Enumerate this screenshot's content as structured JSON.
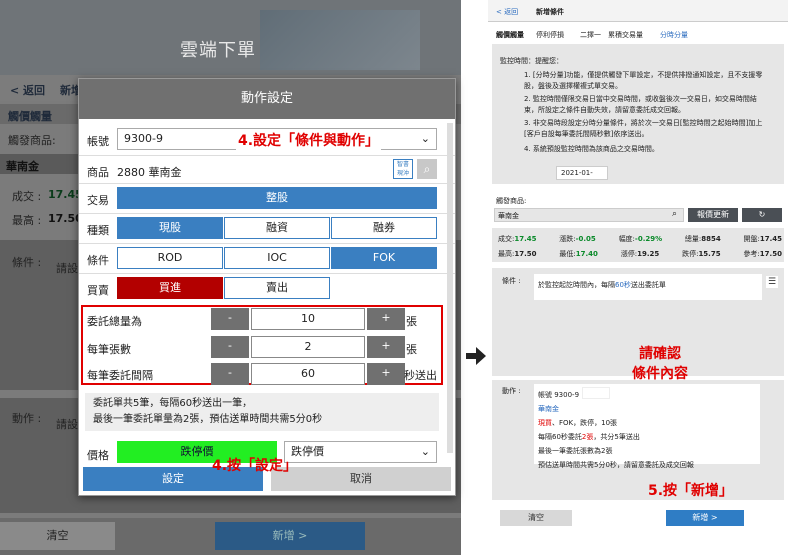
{
  "left_app": {
    "header_title": "雲端下單",
    "back": "< 返回",
    "nav_title": "新增",
    "tab": "觸價觸量",
    "tab2": "停",
    "monitor_label": "觸發商品:",
    "stock": "華南金",
    "deal_label": "成交 :",
    "deal_value": "17.45",
    "high_label": "最高 :",
    "high_value": "17.50",
    "condition_label": "條件 :",
    "condition_text": "請設",
    "action_label": "動作 :",
    "action_text": "請設",
    "clear_button": "清空",
    "new_button": "新增 >"
  },
  "dialog": {
    "title": "動作設定",
    "account_label": "帳號",
    "account_value": "9300-9",
    "product_label": "商品",
    "product_value": "2880 華南金",
    "quote_icon_text": "智書\n現沖",
    "trade_label": "交易",
    "trade_value": "整股",
    "type_label": "種類",
    "type_options": [
      "現股",
      "融資",
      "融券"
    ],
    "cond_label": "條件",
    "cond_options": [
      "ROD",
      "IOC",
      "FOK"
    ],
    "buysell_label": "買賣",
    "buysell_options": [
      "買進",
      "賣出"
    ],
    "qty_total_label": "委託總量為",
    "qty_total_value": "10",
    "qty_total_unit": "張",
    "qty_each_label": "每筆張數",
    "qty_each_value": "2",
    "qty_each_unit": "張",
    "interval_label": "每筆委託間隔",
    "interval_value": "60",
    "interval_unit": "秒送出",
    "minus": "-",
    "plus": "+",
    "summary_line1": "委託單共5筆，每隔60秒送出一筆，",
    "summary_line2": "最後一筆委託單量為2張，預估送單時間共需5分0秒",
    "price_label": "價格",
    "price_value": "跌停價",
    "price_select": "跌停價",
    "confirm_button": "設定",
    "cancel_button": "取消"
  },
  "annotations": {
    "set_condition": "4.設定「條件與動作」",
    "press_set": "4.按「設定」",
    "confirm": "請確認\n條件內容",
    "press_new": "5.按「新增」"
  },
  "right_panel": {
    "back": "< 返回",
    "title": "新增條件",
    "tabs": [
      "觸價觸量",
      "停利停損",
      "二擇一",
      "累積交易量",
      "分時分量"
    ],
    "notice_title": "監控時間：提醒您：",
    "notices": [
      "[分時分量]功能，僅提供觸發下單設定，不提供排撥通知設定，且不支援零股，盤後及選擇權複式單交易。",
      "監控時間僅限交易日當中交易時間，或收盤後次一交易日，如交易時間結束，所設定之條件自動失效，請留意委託成交回報。",
      "非交易時段設定分時分量條件，將於次一交易日[監控時間之起始時間]加上[客戶自設每筆委託間隔秒數]依序送出。",
      "系統預設監控時間為該商品之交易時間。"
    ],
    "date_value": "2021-01-",
    "monitor_label": "觸發商品:",
    "stock": "華南金",
    "quote_button": "報價更新",
    "quotes_row1": [
      [
        "成交:",
        "17.45"
      ],
      [
        "漲跌:",
        "-0.05"
      ],
      [
        "幅度:",
        "-0.29%"
      ],
      [
        "總量:",
        "8854"
      ],
      [
        "開盤:",
        "17.45"
      ]
    ],
    "quotes_row2": [
      [
        "最高:",
        "17.50"
      ],
      [
        "最低:",
        "17.40"
      ],
      [
        "漲停:",
        "19.25"
      ],
      [
        "跌停:",
        "15.75"
      ],
      [
        "參考:",
        "17.50"
      ]
    ],
    "condition_label": "條件 :",
    "condition_text_pre": "於監控起訖時間內，每隔",
    "condition_seconds": "60秒",
    "condition_text_post": "送出委託單",
    "action_label": "動作 :",
    "action_account": "帳號 9300-9",
    "action_stock": "華南金",
    "action_line1_buy": "現買",
    "action_line1_rest": "、FOK，跌停，10張",
    "action_line2_pre": "每隔60秒委託",
    "action_line2_qty": "2張",
    "action_line2_post": "，共分5筆送出",
    "action_line3": "最後一筆委託張數為2張",
    "action_line4": "預估送單時間共需5分0秒，請留意委託及成交回報",
    "clear_button": "清空",
    "new_button": "新增 >"
  },
  "colors": {
    "accent_blue": "#3a7fc1",
    "buy_red": "#b30000",
    "annotation_red": "#e00000",
    "price_green": "#22ee22"
  }
}
